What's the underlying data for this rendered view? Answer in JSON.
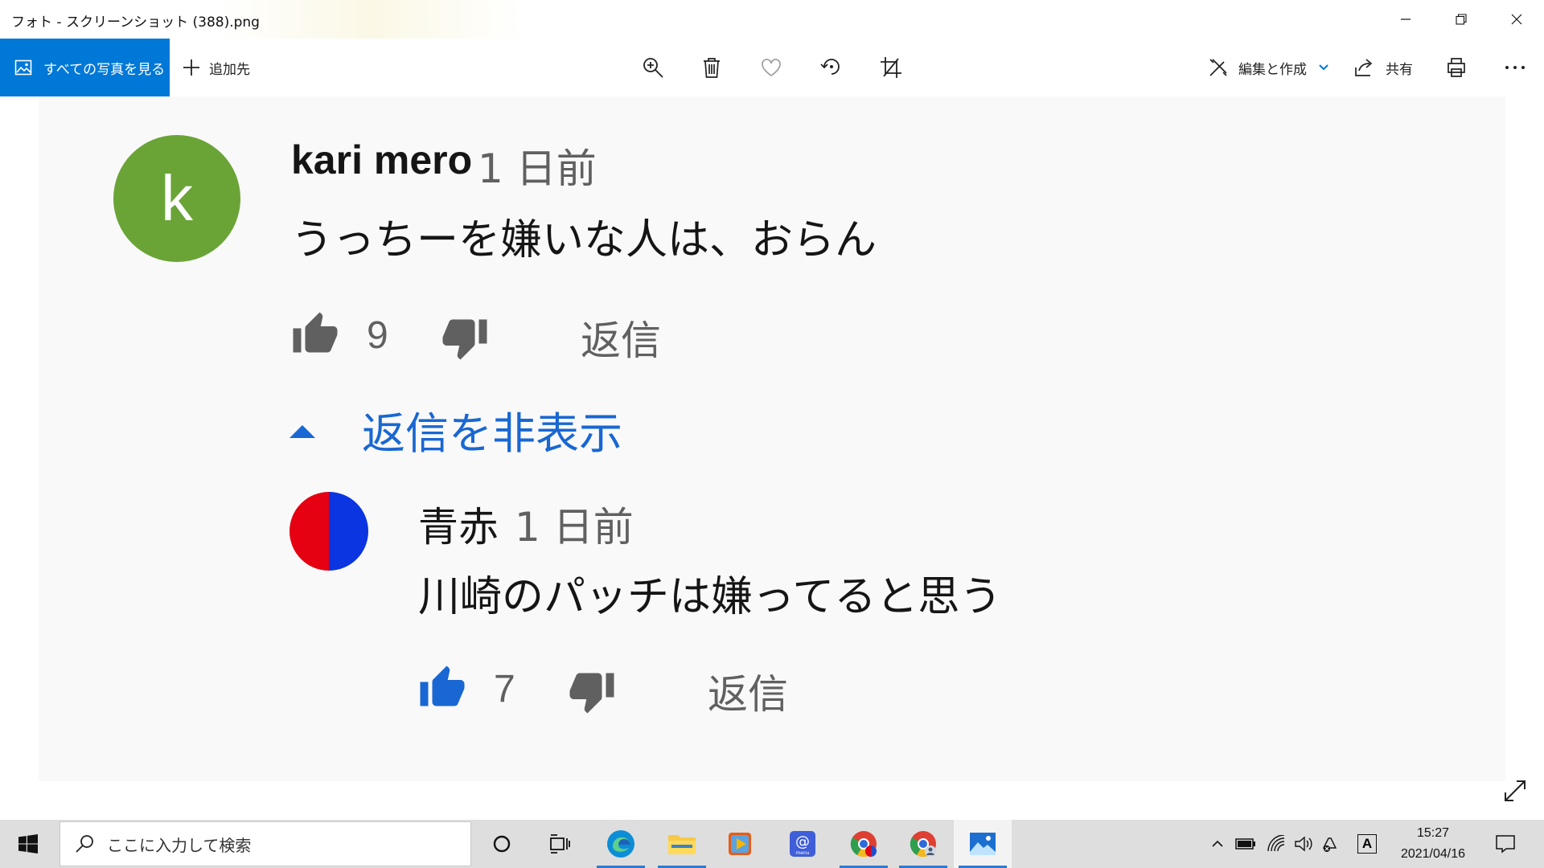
{
  "window": {
    "title": "フォト - スクリーンショット (388).png"
  },
  "toolbar": {
    "see_all_label": "すべての写真を見る",
    "add_to_label": "追加先",
    "edit_create_label": "編集と作成",
    "share_label": "共有"
  },
  "comment": {
    "avatar_letter": "k",
    "author": "kari mero",
    "time": "1 日前",
    "text": "うっちーを嫌いな人は、おらん",
    "likes": "9",
    "reply_label": "返信"
  },
  "hide_replies_label": "返信を非表示",
  "reply": {
    "author": "青赤",
    "time": "1 日前",
    "text": "川崎のパッチは嫌ってると思う",
    "likes": "7",
    "reply_label": "返信"
  },
  "taskbar": {
    "search_placeholder": "ここに入力して検索",
    "time": "15:27",
    "date": "2021/04/16",
    "ime_mode": "A"
  },
  "colors": {
    "accent": "#0078d7",
    "link_blue": "#1967d2",
    "avatar_green": "#6aa437",
    "avatar_red": "#e50012",
    "avatar_blue": "#0a35e0"
  }
}
